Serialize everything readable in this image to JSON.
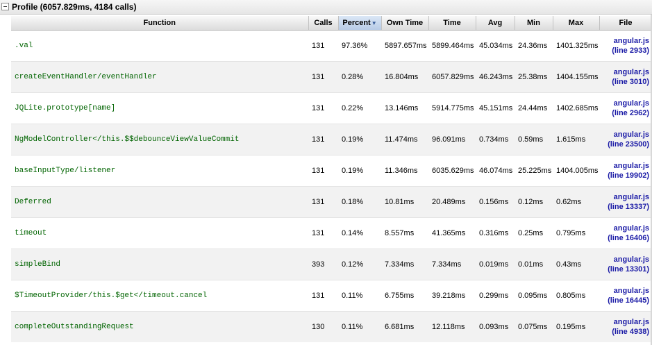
{
  "profile": {
    "title": "Profile (6057.829ms, 4184 calls)"
  },
  "columns": {
    "function": "Function",
    "calls": "Calls",
    "percent": "Percent",
    "own_time": "Own Time",
    "time": "Time",
    "avg": "Avg",
    "min": "Min",
    "max": "Max",
    "file": "File"
  },
  "sort": {
    "column": "percent",
    "direction": "descending"
  },
  "rows": [
    {
      "function": ".val",
      "calls": "131",
      "percent": "97.36%",
      "own_time": "5897.657ms",
      "time": "5899.464ms",
      "avg": "45.034ms",
      "min": "24.36ms",
      "max": "1401.325ms",
      "file": "angular.js",
      "line": "(line 2933)"
    },
    {
      "function": "createEventHandler/eventHandler",
      "calls": "131",
      "percent": "0.28%",
      "own_time": "16.804ms",
      "time": "6057.829ms",
      "avg": "46.243ms",
      "min": "25.38ms",
      "max": "1404.155ms",
      "file": "angular.js",
      "line": "(line 3010)"
    },
    {
      "function": "JQLite.prototype[name]",
      "calls": "131",
      "percent": "0.22%",
      "own_time": "13.146ms",
      "time": "5914.775ms",
      "avg": "45.151ms",
      "min": "24.44ms",
      "max": "1402.685ms",
      "file": "angular.js",
      "line": "(line 2962)"
    },
    {
      "function": "NgModelController</this.$$debounceViewValueCommit",
      "calls": "131",
      "percent": "0.19%",
      "own_time": "11.474ms",
      "time": "96.091ms",
      "avg": "0.734ms",
      "min": "0.59ms",
      "max": "1.615ms",
      "file": "angular.js",
      "line": "(line 23500)"
    },
    {
      "function": "baseInputType/listener",
      "calls": "131",
      "percent": "0.19%",
      "own_time": "11.346ms",
      "time": "6035.629ms",
      "avg": "46.074ms",
      "min": "25.225ms",
      "max": "1404.005ms",
      "file": "angular.js",
      "line": "(line 19902)"
    },
    {
      "function": "Deferred",
      "calls": "131",
      "percent": "0.18%",
      "own_time": "10.81ms",
      "time": "20.489ms",
      "avg": "0.156ms",
      "min": "0.12ms",
      "max": "0.62ms",
      "file": "angular.js",
      "line": "(line 13337)"
    },
    {
      "function": "timeout",
      "calls": "131",
      "percent": "0.14%",
      "own_time": "8.557ms",
      "time": "41.365ms",
      "avg": "0.316ms",
      "min": "0.25ms",
      "max": "0.795ms",
      "file": "angular.js",
      "line": "(line 16406)"
    },
    {
      "function": "simpleBind",
      "calls": "393",
      "percent": "0.12%",
      "own_time": "7.334ms",
      "time": "7.334ms",
      "avg": "0.019ms",
      "min": "0.01ms",
      "max": "0.43ms",
      "file": "angular.js",
      "line": "(line 13301)"
    },
    {
      "function": "$TimeoutProvider/this.$get</timeout.cancel",
      "calls": "131",
      "percent": "0.11%",
      "own_time": "6.755ms",
      "time": "39.218ms",
      "avg": "0.299ms",
      "min": "0.095ms",
      "max": "0.805ms",
      "file": "angular.js",
      "line": "(line 16445)"
    },
    {
      "function": "completeOutstandingRequest",
      "calls": "130",
      "percent": "0.11%",
      "own_time": "6.681ms",
      "time": "12.118ms",
      "avg": "0.093ms",
      "min": "0.075ms",
      "max": "0.195ms",
      "file": "angular.js",
      "line": "(line 4938)"
    }
  ]
}
